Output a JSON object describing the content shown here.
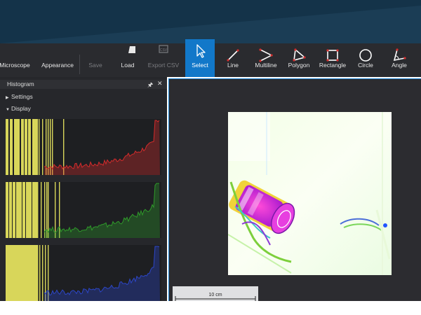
{
  "toolbar": {
    "items": [
      {
        "label": "Microscope",
        "icon": "microscope-icon",
        "state": "normal"
      },
      {
        "label": "Appearance",
        "icon": "appearance-icon",
        "state": "normal"
      },
      {
        "label": "Save",
        "icon": "save-icon",
        "state": "disabled"
      },
      {
        "label": "Load",
        "icon": "folder-icon",
        "state": "normal"
      },
      {
        "label": "Export CSV",
        "icon": "csv-icon",
        "state": "disabled"
      },
      {
        "label": "Select",
        "icon": "cursor-icon",
        "state": "active"
      },
      {
        "label": "Line",
        "icon": "line-icon",
        "state": "normal"
      },
      {
        "label": "Multiline",
        "icon": "multiline-icon",
        "state": "normal"
      },
      {
        "label": "Polygon",
        "icon": "polygon-icon",
        "state": "normal"
      },
      {
        "label": "Rectangle",
        "icon": "rectangle-icon",
        "state": "normal"
      },
      {
        "label": "Circle",
        "icon": "circle-icon",
        "state": "normal"
      },
      {
        "label": "Angle",
        "icon": "angle-icon",
        "state": "normal"
      }
    ]
  },
  "histogram_panel": {
    "title": "Histogram",
    "settings_label": "Settings",
    "display_label": "Display",
    "channels": [
      {
        "name": "red",
        "color": "#d42b2b"
      },
      {
        "name": "green",
        "color": "#2f9a2a"
      },
      {
        "name": "blue",
        "color": "#2c46c8"
      }
    ],
    "clip_color": "#d8d65a"
  },
  "scalebar": {
    "label": "10 cm"
  },
  "colors": {
    "accent": "#1278c9",
    "banner": "#143349"
  }
}
